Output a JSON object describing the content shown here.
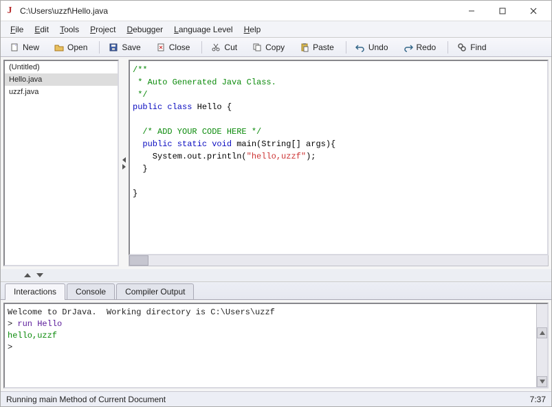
{
  "title": "C:\\Users\\uzzf\\Hello.java",
  "menu": {
    "file": "File",
    "edit": "Edit",
    "tools": "Tools",
    "project": "Project",
    "debugger": "Debugger",
    "language": "Language Level",
    "help": "Help"
  },
  "toolbar": {
    "new": "New",
    "open": "Open",
    "save": "Save",
    "close": "Close",
    "cut": "Cut",
    "copy": "Copy",
    "paste": "Paste",
    "undo": "Undo",
    "redo": "Redo",
    "find": "Find"
  },
  "files": [
    "(Untitled)",
    "Hello.java",
    "uzzf.java"
  ],
  "selected_file": 1,
  "code": {
    "l1": "/**",
    "l2": " * Auto Generated Java Class.",
    "l3": " */",
    "l4_a": "public class",
    "l4_b": " Hello {",
    "l5": "  ",
    "l6": "  /* ADD YOUR CODE HERE */",
    "l7_a": "  public static void",
    "l7_b": " main(String[] args){",
    "l8_a": "    System.out.println(",
    "l8_b": "\"hello,uzzf\"",
    "l8_c": ");",
    "l9": "  }",
    "l10": "  ",
    "l11": "}"
  },
  "tabs": {
    "interactions": "Interactions",
    "console": "Console",
    "compiler": "Compiler Output"
  },
  "active_tab": "interactions",
  "console_lines": {
    "welcome": "Welcome to DrJava.  Working directory is C:\\Users\\uzzf",
    "prompt1": "> ",
    "cmd1": "run Hello",
    "out1": "hello,uzzf",
    "prompt2": "> "
  },
  "status": {
    "left": "Running main Method of Current Document",
    "right": "7:37"
  }
}
